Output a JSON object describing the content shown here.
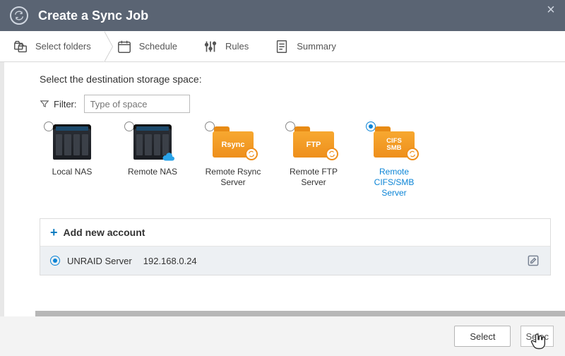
{
  "window": {
    "title": "Create a Sync Job"
  },
  "steps": {
    "select_folders": "Select folders",
    "schedule": "Schedule",
    "rules": "Rules",
    "summary": "Summary"
  },
  "destination": {
    "heading": "Select the destination storage space:",
    "filter_label": "Filter:",
    "filter_placeholder": "Type of space",
    "options": {
      "local_nas": "Local NAS",
      "remote_nas": "Remote NAS",
      "remote_rsync": "Remote Rsync Server",
      "remote_ftp": "Remote FTP Server",
      "remote_cifs": "Remote CIFS/SMB Server"
    },
    "folder_badges": {
      "rsync": "Rsync",
      "ftp": "FTP",
      "cifs": "CIFS\nSMB"
    }
  },
  "accounts": {
    "add_label": "Add new account",
    "rows": [
      {
        "name": "UNRAID Server",
        "ip": "192.168.0.24",
        "selected": true
      }
    ]
  },
  "buttons": {
    "select": "Select",
    "select_trail": "Selec"
  }
}
